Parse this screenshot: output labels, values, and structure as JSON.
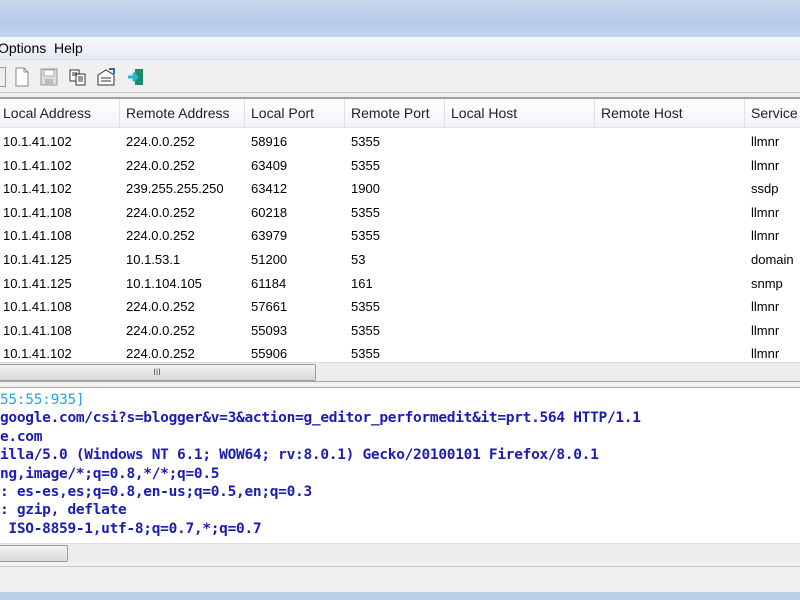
{
  "menu": {
    "items": [
      "Options",
      "Help"
    ]
  },
  "toolbar": {
    "icons": [
      "toolbar-edge-icon",
      "new-file-icon",
      "save-icon",
      "copy-icon",
      "properties-icon",
      "exit-icon"
    ]
  },
  "table": {
    "columns": [
      "Local Address",
      "Remote Address",
      "Local Port",
      "Remote Port",
      "Local Host",
      "Remote Host",
      "Service"
    ],
    "rows": [
      [
        "10.1.41.102",
        "224.0.0.252",
        "58916",
        "5355",
        "",
        "",
        "llmnr"
      ],
      [
        "10.1.41.102",
        "224.0.0.252",
        "63409",
        "5355",
        "",
        "",
        "llmnr"
      ],
      [
        "10.1.41.102",
        "239.255.255.250",
        "63412",
        "1900",
        "",
        "",
        "ssdp"
      ],
      [
        "10.1.41.108",
        "224.0.0.252",
        "60218",
        "5355",
        "",
        "",
        "llmnr"
      ],
      [
        "10.1.41.108",
        "224.0.0.252",
        "63979",
        "5355",
        "",
        "",
        "llmnr"
      ],
      [
        "10.1.41.125",
        "10.1.53.1",
        "51200",
        "53",
        "",
        "",
        "domain"
      ],
      [
        "10.1.41.125",
        "10.1.104.105",
        "61184",
        "161",
        "",
        "",
        "snmp"
      ],
      [
        "10.1.41.108",
        "224.0.0.252",
        "57661",
        "5355",
        "",
        "",
        "llmnr"
      ],
      [
        "10.1.41.108",
        "224.0.0.252",
        "55093",
        "5355",
        "",
        "",
        "llmnr"
      ],
      [
        "10.1.41.102",
        "224.0.0.252",
        "55906",
        "5355",
        "",
        "",
        "llmnr"
      ]
    ]
  },
  "scrollbar": {
    "grip": "III"
  },
  "details": {
    "timestamp": "55:55:935]",
    "lines": [
      "google.com/csi?s=blogger&v=3&action=g_editor_performedit&it=prt.564 HTTP/1.1",
      "e.com",
      "illa/5.0 (Windows NT 6.1; WOW64; rv:8.0.1) Gecko/20100101 Firefox/8.0.1",
      "ng,image/*;q=0.8,*/*;q=0.5",
      ": es-es,es;q=0.8,en-us;q=0.5,en;q=0.3",
      ": gzip, deflate",
      " ISO-8859-1,utf-8;q=0.7,*;q=0.7"
    ],
    "timestamp_color": "#2aa6d8",
    "text_color": "#1c1cb4"
  }
}
